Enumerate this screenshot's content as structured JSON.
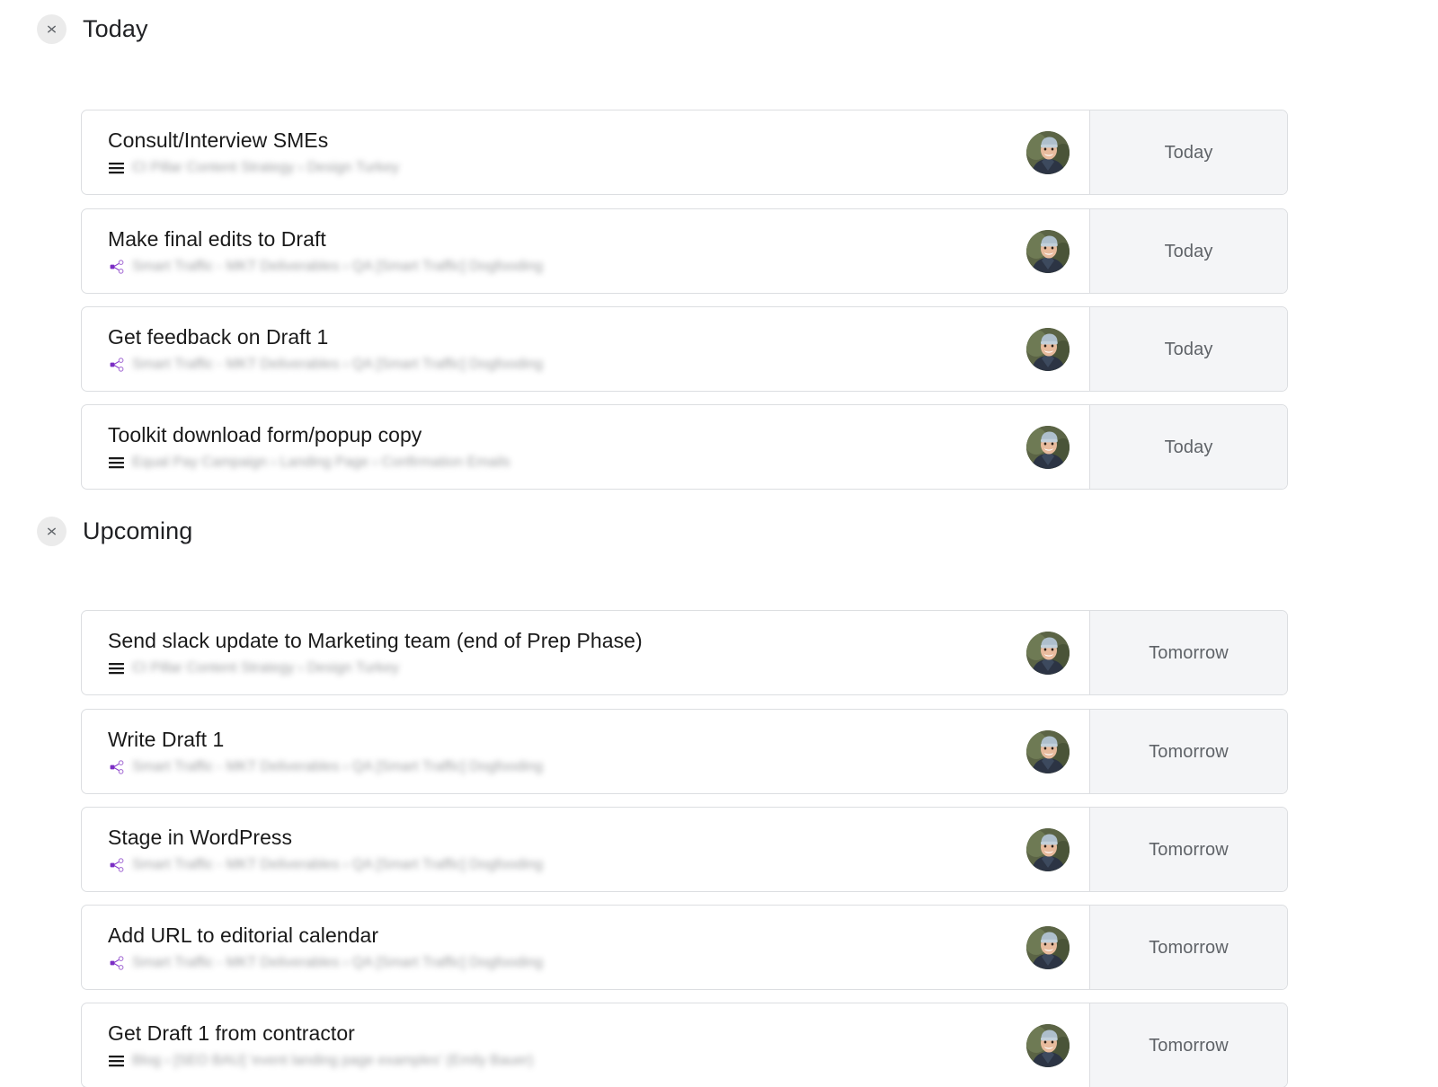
{
  "theme": {
    "page_bg": "#ffffff",
    "card_border": "#dcdee1",
    "date_cell_bg": "#f4f5f7",
    "title_color": "#1a1a1a",
    "breadcrumb_color": "#8b8d90",
    "date_color": "#5f6368",
    "accent_purple": "#8b3ecf",
    "collapse_circle_bg": "#ebebeb"
  },
  "sections": [
    {
      "id": "today",
      "title": "Today",
      "collapse_icon": "collapse-chevrons-icon",
      "tasks": [
        {
          "title": "Consult/Interview SMEs",
          "breadcrumb": "CI Pillar Content Strategy › Design Turkey",
          "breadcrumb_icon": "list-icon",
          "avatar": "user-avatar",
          "date": "Today"
        },
        {
          "title": "Make final edits to Draft",
          "breadcrumb": "Smart Traffic - MKT Deliverables › QA [Smart Traffic] Dogfooding",
          "breadcrumb_icon": "share-node-icon",
          "avatar": "user-avatar",
          "date": "Today"
        },
        {
          "title": "Get feedback on Draft 1",
          "breadcrumb": "Smart Traffic - MKT Deliverables › QA [Smart Traffic] Dogfooding",
          "breadcrumb_icon": "share-node-icon",
          "avatar": "user-avatar",
          "date": "Today"
        },
        {
          "title": "Toolkit download form/popup copy",
          "breadcrumb": "Equal Pay Campaign › Landing Page › Confirmation Emails",
          "breadcrumb_icon": "list-icon",
          "avatar": "user-avatar",
          "date": "Today"
        }
      ]
    },
    {
      "id": "upcoming",
      "title": "Upcoming",
      "collapse_icon": "collapse-chevrons-icon",
      "tasks": [
        {
          "title": "Send slack update to Marketing team (end of Prep Phase)",
          "breadcrumb": "CI Pillar Content Strategy › Design Turkey",
          "breadcrumb_icon": "list-icon",
          "avatar": "user-avatar",
          "date": "Tomorrow"
        },
        {
          "title": "Write Draft 1",
          "breadcrumb": "Smart Traffic - MKT Deliverables › QA [Smart Traffic] Dogfooding",
          "breadcrumb_icon": "share-node-icon",
          "avatar": "user-avatar",
          "date": "Tomorrow"
        },
        {
          "title": "Stage in WordPress",
          "breadcrumb": "Smart Traffic - MKT Deliverables › QA [Smart Traffic] Dogfooding",
          "breadcrumb_icon": "share-node-icon",
          "avatar": "user-avatar",
          "date": "Tomorrow"
        },
        {
          "title": "Add URL to editorial calendar",
          "breadcrumb": "Smart Traffic - MKT Deliverables › QA [Smart Traffic] Dogfooding",
          "breadcrumb_icon": "share-node-icon",
          "avatar": "user-avatar",
          "date": "Tomorrow"
        },
        {
          "title": "Get Draft 1 from contractor",
          "breadcrumb": "Blog › [SEO BAU] 'event landing page examples' (Emily Bauer)",
          "breadcrumb_icon": "list-icon",
          "avatar": "user-avatar",
          "date": "Tomorrow"
        }
      ]
    }
  ],
  "layout": {
    "section_tops": [
      14,
      573
    ],
    "today_card_tops": [
      86,
      196,
      305,
      414
    ],
    "upcoming_card_tops": [
      643,
      753,
      862,
      971,
      1080
    ]
  }
}
